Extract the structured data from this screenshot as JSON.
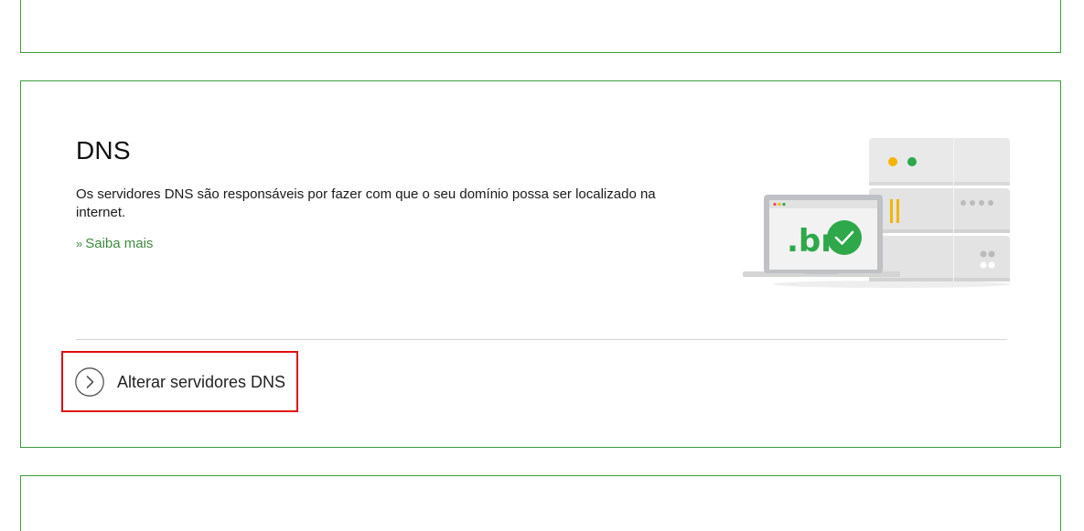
{
  "dns_card": {
    "title": "DNS",
    "description": "Os servidores DNS são responsáveis por fazer com que o seu domínio possa ser localizado na internet.",
    "learn_more_prefix": "»",
    "learn_more_label": "Saiba mais",
    "action_label": "Alterar servidores DNS",
    "illustration_text": ".br"
  },
  "colors": {
    "border": "#3d9a3d",
    "link": "#3d8b3d",
    "highlight": "#e01010",
    "brand_green": "#2ea84a",
    "accent_yellow": "#f2b600"
  },
  "icons": {
    "action_icon": "chevron-right-circle-icon",
    "illustration": "dns-server-illustration"
  }
}
